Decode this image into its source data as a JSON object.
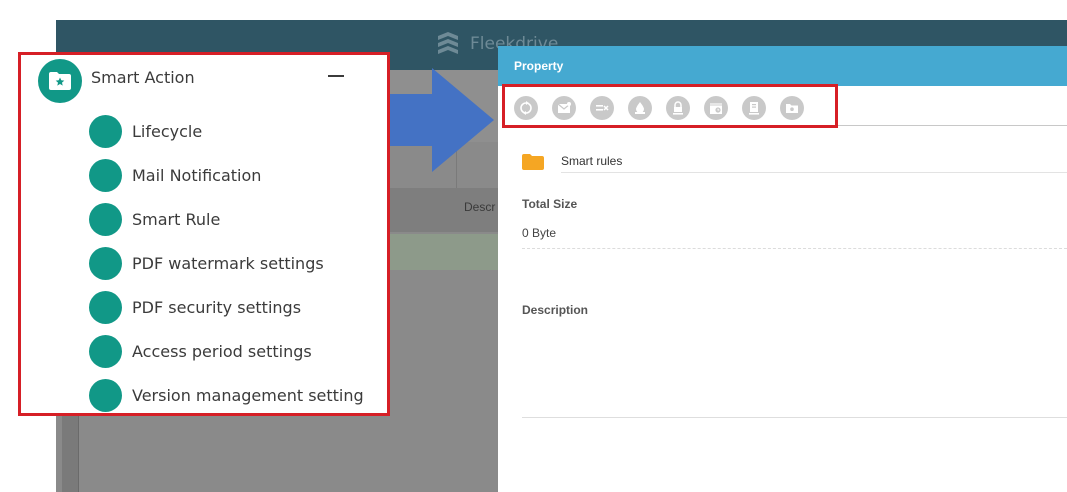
{
  "app": {
    "logo_text": "Fleekdrive",
    "grid_header": "Descr"
  },
  "property_panel": {
    "title": "Property",
    "toolbar": [
      {
        "name": "lifecycle-icon"
      },
      {
        "name": "mail-notification-icon"
      },
      {
        "name": "smart-rule-icon"
      },
      {
        "name": "pdf-watermark-icon"
      },
      {
        "name": "pdf-security-icon"
      },
      {
        "name": "access-period-icon"
      },
      {
        "name": "version-management-icon"
      },
      {
        "name": "folder-settings-icon"
      }
    ],
    "folder_name": "Smart rules",
    "total_size_label": "Total Size",
    "total_size_value": "0 Byte",
    "description_label": "Description"
  },
  "smart_action": {
    "title": "Smart Action",
    "items": [
      {
        "label": "Lifecycle"
      },
      {
        "label": "Mail Notification"
      },
      {
        "label": "Smart Rule"
      },
      {
        "label": "PDF watermark settings"
      },
      {
        "label": "PDF security settings"
      },
      {
        "label": "Access period settings"
      },
      {
        "label": "Version management setting"
      }
    ]
  },
  "colors": {
    "header_blue": "#45a9d1",
    "teal": "#119887",
    "highlight_red": "#d61f26",
    "arrow_blue": "#4472c4",
    "folder_orange": "#f5a623",
    "topbar": "#2f5564"
  }
}
